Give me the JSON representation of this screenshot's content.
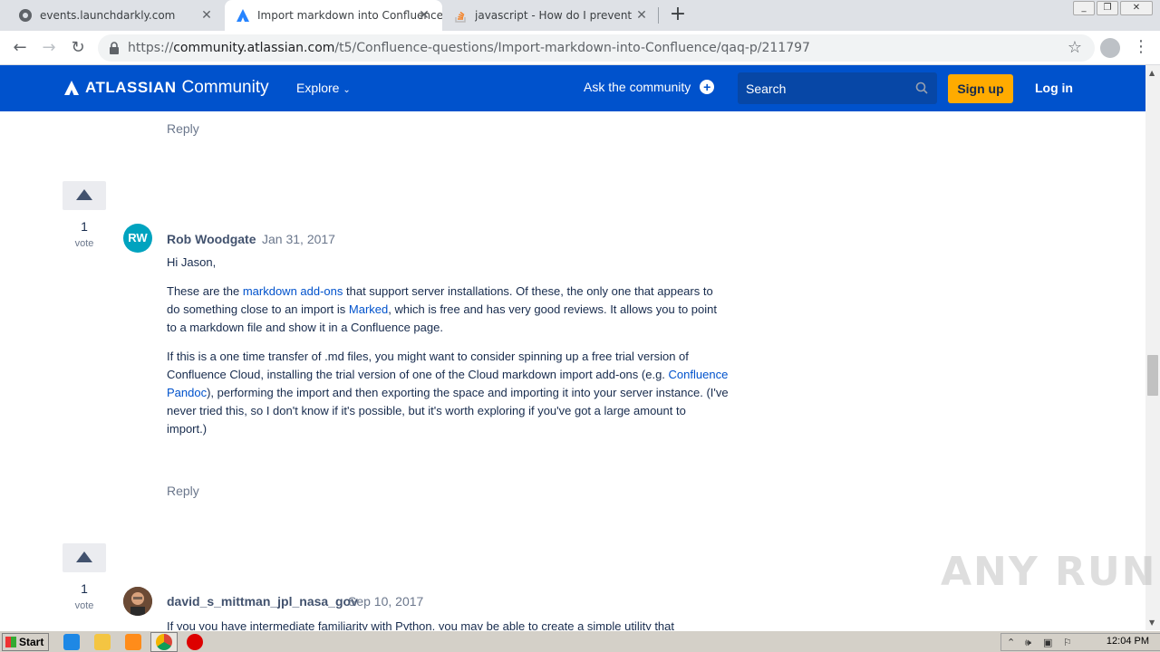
{
  "browser": {
    "tabs": [
      {
        "title": "events.launchdarkly.com",
        "active": false
      },
      {
        "title": "Import markdown into Confluence",
        "active": true
      },
      {
        "title": "javascript - How do I prevent Googl",
        "active": false
      }
    ],
    "new_tab": "+",
    "url_scheme": "https://",
    "url_host": "community.atlassian.com",
    "url_path": "/t5/Confluence-questions/Import-markdown-into-Confluence/qaq-p/211797"
  },
  "header": {
    "brand": "ATLASSIAN",
    "community": "Community",
    "explore": "Explore",
    "ask": "Ask the community",
    "search_placeholder": "Search",
    "signup": "Sign up",
    "login": "Log in",
    "colors": {
      "bar": "#0052cc",
      "signup": "#ffab00"
    }
  },
  "content": {
    "reply_top": "Reply",
    "answers": [
      {
        "votes": "1",
        "vote_label": "vote",
        "avatar_initials": "RW",
        "author": "Rob Woodgate",
        "date": "Jan 31, 2017",
        "greeting": "Hi Jason,",
        "p1_a": "These are the ",
        "p1_link1": "markdown add-ons",
        "p1_b": " that support server installations.  Of these, the only one that appears to do something close to an import is ",
        "p1_link2": "Marked",
        "p1_c": ", which is free and has very good reviews.  It allows you to point to a markdown file and show it in a Confluence page.",
        "p2_a": "If this is a one time transfer of .md files, you might want to consider spinning up a free trial version of Confluence Cloud, installing the trial version of one of the Cloud markdown import add-ons (e.g. ",
        "p2_link": "Confluence Pandoc",
        "p2_b": "), performing the import and then exporting the space and importing it into your server instance. (I've never tried this, so I don't know if it's possible, but it's worth exploring if you've got a large amount to import.)",
        "reply": "Reply"
      },
      {
        "votes": "1",
        "vote_label": "vote",
        "author": "david_s_mittman_jpl_nasa_gov",
        "date": "Sep 10, 2017",
        "p1": "If you you have intermediate familiarity with Python, you may be able to create a simple utility that"
      }
    ]
  },
  "watermark": "ANY RUN",
  "taskbar": {
    "start": "Start",
    "time": "12:04 PM"
  }
}
